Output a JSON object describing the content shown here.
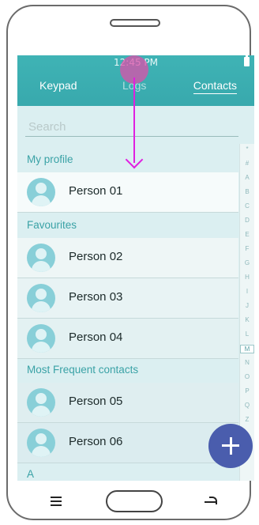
{
  "status": {
    "time": "12:45 PM"
  },
  "tabs": {
    "keypad": "Keypad",
    "logs": "Logs",
    "contacts": "Contacts"
  },
  "search": {
    "placeholder": "Search"
  },
  "sections": {
    "my_profile": "My profile",
    "favourites": "Favourites",
    "most_frequent": "Most Frequent contacts",
    "a": "A"
  },
  "contacts": {
    "profile": "Person 01",
    "fav": [
      "Person 02",
      "Person 03",
      "Person 04"
    ],
    "frequent": [
      "Person 05",
      "Person 06"
    ]
  },
  "index": [
    "*",
    "#",
    "A",
    "B",
    "C",
    "D",
    "E",
    "F",
    "G",
    "H",
    "I",
    "J",
    "K",
    "L",
    "M",
    "N",
    "O",
    "P",
    "Q",
    "Z"
  ],
  "active_index": "M",
  "colors": {
    "accent": "#3fb3b5",
    "fab": "#4a5dad",
    "section_text": "#3aa2a6",
    "gesture": "#e020e0"
  },
  "icons": {
    "fab": "plus-icon",
    "menu": "menu-icon",
    "home": "home-button",
    "back": "back-icon"
  }
}
